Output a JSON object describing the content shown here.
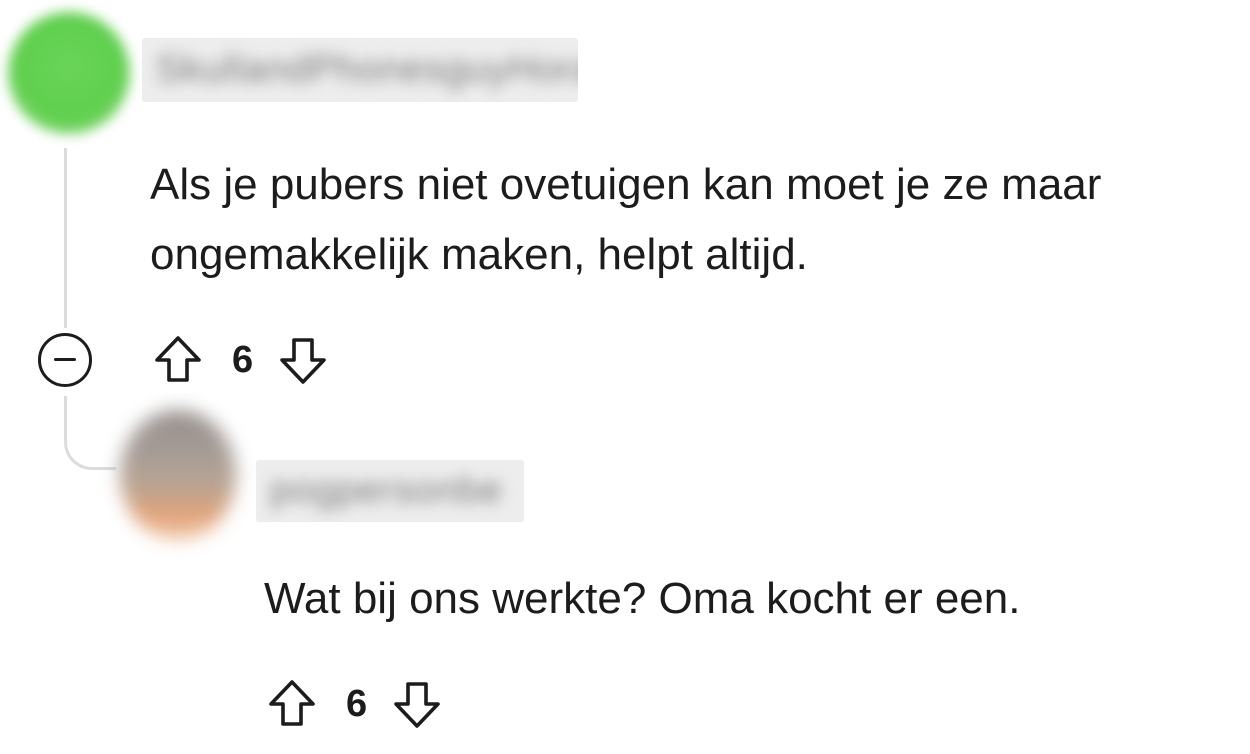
{
  "comments": [
    {
      "username": "SkullandPhonesguyHoracio",
      "body_lines": [
        "Als je pubers niet ovetuigen kan moet je ze maar",
        "ongemakkelijk maken, helpt altijd."
      ],
      "score": "6",
      "icons": {
        "upvote": "arrow-up-icon",
        "downvote": "arrow-down-icon",
        "collapse": "minus-circle-icon"
      }
    },
    {
      "username": "pogpersonbe",
      "body_lines": [
        "Wat bij ons werkte? Oma kocht er een."
      ],
      "score": "6",
      "icons": {
        "upvote": "arrow-up-icon",
        "downvote": "arrow-down-icon"
      }
    }
  ],
  "colors": {
    "text": "#1c1c1c",
    "thread_line": "#dadcde",
    "avatar_1": "#5fcf4d"
  }
}
